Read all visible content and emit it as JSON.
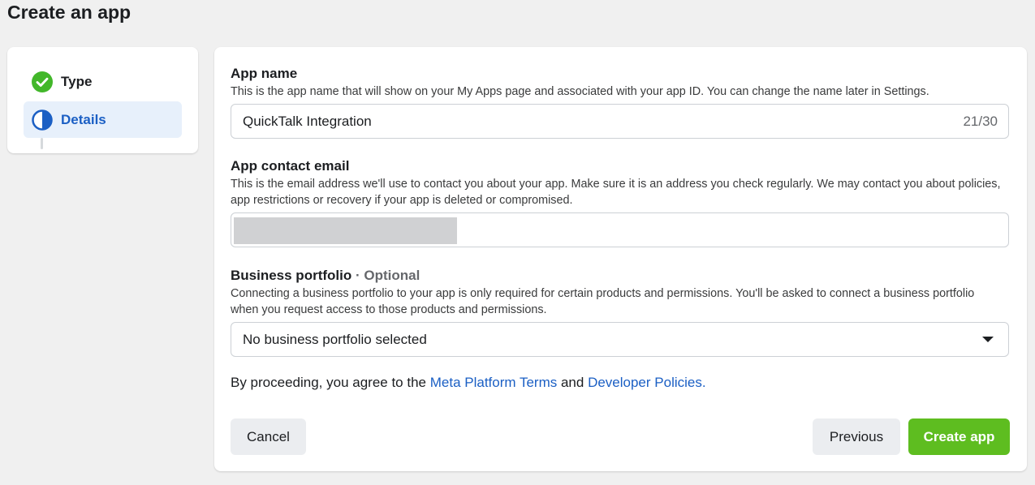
{
  "page": {
    "title": "Create an app"
  },
  "steps": [
    {
      "label": "Type",
      "status": "complete",
      "icon": "check-circle-icon"
    },
    {
      "label": "Details",
      "status": "in-progress",
      "icon": "half-circle-icon"
    }
  ],
  "form": {
    "app_name": {
      "title": "App name",
      "description": "This is the app name that will show on your My Apps page and associated with your app ID. You can change the name later in Settings.",
      "value": "QuickTalk Integration",
      "counter": "21/30"
    },
    "contact_email": {
      "title": "App contact email",
      "description": "This is the email address we'll use to contact you about your app. Make sure it is an address you check regularly. We may contact you about policies, app restrictions or recovery if your app is deleted or compromised.",
      "value": ""
    },
    "business_portfolio": {
      "title": "Business portfolio",
      "optional": "· Optional",
      "description": "Connecting a business portfolio to your app is only required for certain products and permissions. You'll be asked to connect a business portfolio when you request access to those products and permissions.",
      "selected": "No business portfolio selected"
    },
    "terms": {
      "prefix": "By proceeding, you agree to the ",
      "link1": "Meta Platform Terms",
      "middle": " and ",
      "link2": "Developer Policies."
    }
  },
  "buttons": {
    "cancel": "Cancel",
    "previous": "Previous",
    "create": "Create app"
  },
  "colors": {
    "accent_blue": "#1b5fc4",
    "success_green": "#42b72a",
    "create_button": "#5ebd20",
    "active_step_bg": "#e7f0fb"
  }
}
